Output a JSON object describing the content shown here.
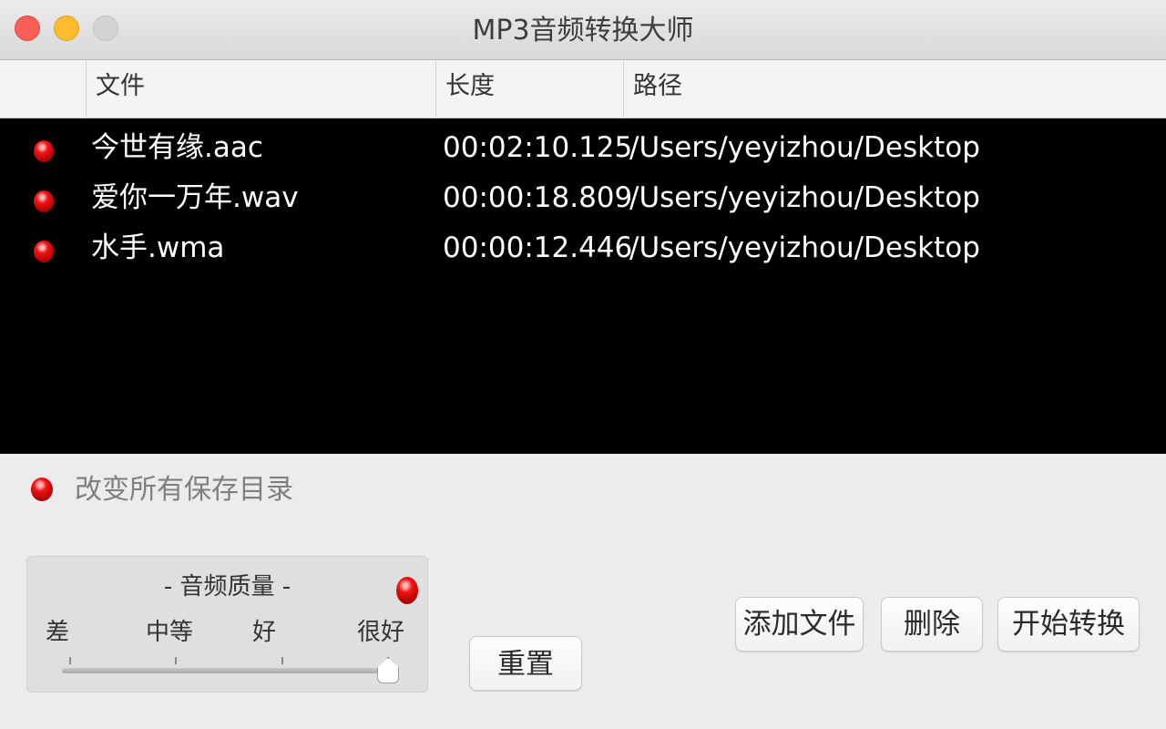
{
  "window": {
    "title": "MP3音频转换大师"
  },
  "table": {
    "columns": [
      "文件",
      "长度",
      "路径"
    ],
    "rows": [
      {
        "file": "今世有缘.aac",
        "length": "00:02:10.125",
        "path": "/Users/yeyizhou/Desktop",
        "status": "red"
      },
      {
        "file": "爱你一万年.wav",
        "length": "00:00:18.809",
        "path": "/Users/yeyizhou/Desktop",
        "status": "red"
      },
      {
        "file": "水手.wma",
        "length": "00:00:12.446",
        "path": "/Users/yeyizhou/Desktop",
        "status": "red"
      }
    ]
  },
  "save_dir": {
    "label": "改变所有保存目录"
  },
  "quality": {
    "title": "- 音频质量 -",
    "levels": [
      "差",
      "中等",
      "好",
      "很好"
    ],
    "selected_index": 3,
    "selected_fraction": 1.0
  },
  "buttons": {
    "reset": "重置",
    "add_file": "添加文件",
    "delete": "删除",
    "start": "开始转换"
  },
  "colors": {
    "status_led": "#e01010",
    "table_background": "#000000"
  }
}
